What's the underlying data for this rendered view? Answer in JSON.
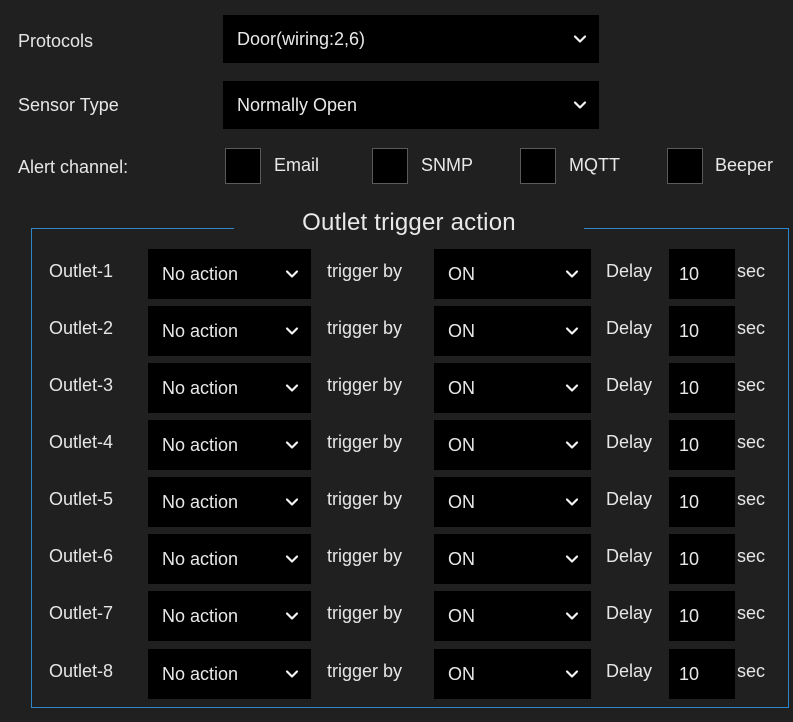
{
  "protocols": {
    "label": "Protocols",
    "value": "Door(wiring:2,6)"
  },
  "sensor_type": {
    "label": "Sensor Type",
    "value": "Normally Open"
  },
  "alert_channel": {
    "label": "Alert channel:",
    "options": [
      {
        "label": "Email",
        "checked": false
      },
      {
        "label": "SNMP",
        "checked": false
      },
      {
        "label": "MQTT",
        "checked": false
      },
      {
        "label": "Beeper",
        "checked": false
      }
    ]
  },
  "outlet_trigger": {
    "title": "Outlet trigger action",
    "trigger_by_label": "trigger by",
    "delay_label": "Delay",
    "sec_label": "sec",
    "rows": [
      {
        "name": "Outlet-1",
        "action": "No action",
        "trigger": "ON",
        "delay": "10"
      },
      {
        "name": "Outlet-2",
        "action": "No action",
        "trigger": "ON",
        "delay": "10"
      },
      {
        "name": "Outlet-3",
        "action": "No action",
        "trigger": "ON",
        "delay": "10"
      },
      {
        "name": "Outlet-4",
        "action": "No action",
        "trigger": "ON",
        "delay": "10"
      },
      {
        "name": "Outlet-5",
        "action": "No action",
        "trigger": "ON",
        "delay": "10"
      },
      {
        "name": "Outlet-6",
        "action": "No action",
        "trigger": "ON",
        "delay": "10"
      },
      {
        "name": "Outlet-7",
        "action": "No action",
        "trigger": "ON",
        "delay": "10"
      },
      {
        "name": "Outlet-8",
        "action": "No action",
        "trigger": "ON",
        "delay": "10"
      }
    ]
  },
  "theme": {
    "background": "#202020",
    "field_background": "#000000",
    "border_accent": "#2f86c8",
    "text": "#e8e8e8"
  }
}
